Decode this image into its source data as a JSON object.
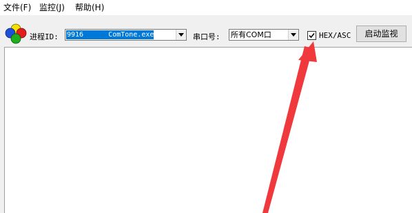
{
  "menu": {
    "items": [
      {
        "label": "文件(F)"
      },
      {
        "label": "监控(J)"
      },
      {
        "label": "帮助(H)"
      }
    ]
  },
  "toolbar": {
    "process_label": "进程ID:",
    "process_selected": "9916      ComTone.exe",
    "port_label": "串口号:",
    "port_selected": "所有COM口",
    "hex_checkbox_label": "HEX/ASC",
    "hex_checked": true,
    "start_button_label": "启动监视"
  },
  "icons": {
    "logo": "four-color-circles-logo",
    "annotation": "red-arrow-annotation"
  },
  "colors": {
    "selection": "#0078d7",
    "arrow": "#f0393c",
    "logo_blue": "#1f4fd6",
    "logo_yellow": "#f4e100",
    "logo_red": "#e11d1d",
    "logo_green": "#1fae1f"
  }
}
